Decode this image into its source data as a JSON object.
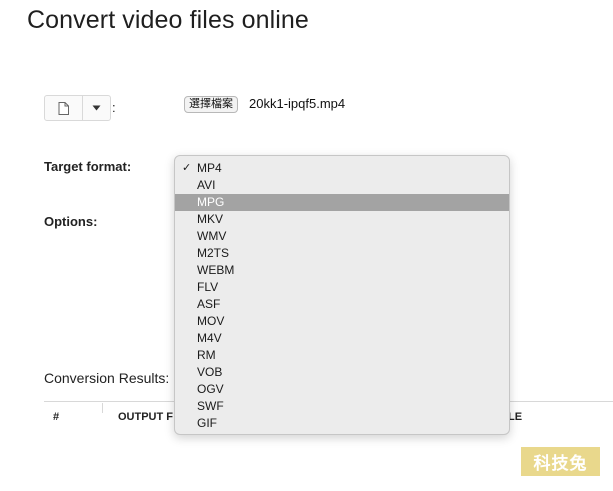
{
  "page": {
    "title": "Convert video files online"
  },
  "file_input": {
    "colon": ":",
    "choose_label": "選擇檔案",
    "file_name": "20kk1-ipqf5.mp4"
  },
  "form": {
    "target_format_label": "Target format:",
    "options_label": "Options:"
  },
  "format_dropdown": {
    "selected": "MP4",
    "highlighted": "MPG",
    "check_glyph": "✓",
    "options": [
      "MP4",
      "AVI",
      "MPG",
      "MKV",
      "WMV",
      "M2TS",
      "WEBM",
      "FLV",
      "ASF",
      "MOV",
      "M4V",
      "RM",
      "VOB",
      "OGV",
      "SWF",
      "GIF"
    ]
  },
  "results": {
    "label": "Conversion Results:",
    "columns": [
      "#",
      "OUTPUT F",
      "LE"
    ]
  },
  "watermark": {
    "text": "科技兔"
  },
  "colors": {
    "dropdown_bg": "#ececec",
    "highlight_bg": "#a3a3a3",
    "watermark_bg": "#e9d88c"
  },
  "icons": {
    "file": "file-icon",
    "caret": "caret-down-icon",
    "check": "checkmark-icon"
  }
}
